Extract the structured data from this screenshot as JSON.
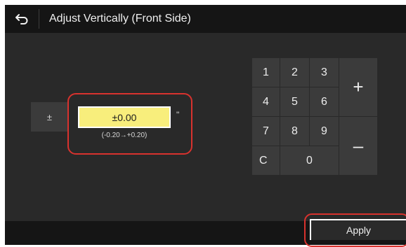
{
  "header": {
    "title": "Adjust Vertically (Front Side)",
    "back_icon": "back-arrow-icon"
  },
  "adjust": {
    "sign_toggle_label": "±",
    "value": "±0.00",
    "unit": "\"",
    "range": "(-0.20→+0.20)"
  },
  "keypad": {
    "keys": [
      "1",
      "2",
      "3",
      "4",
      "5",
      "6",
      "7",
      "8",
      "9",
      "C",
      "0"
    ],
    "plus_label": "+",
    "minus_label": "–"
  },
  "footer": {
    "apply_label": "Apply"
  },
  "colors": {
    "screen_bg": "#292929",
    "bar_bg": "#151515",
    "key_bg": "#3b3b3b",
    "value_bg": "#f8ee7c",
    "highlight_frame": "#d8322e"
  }
}
